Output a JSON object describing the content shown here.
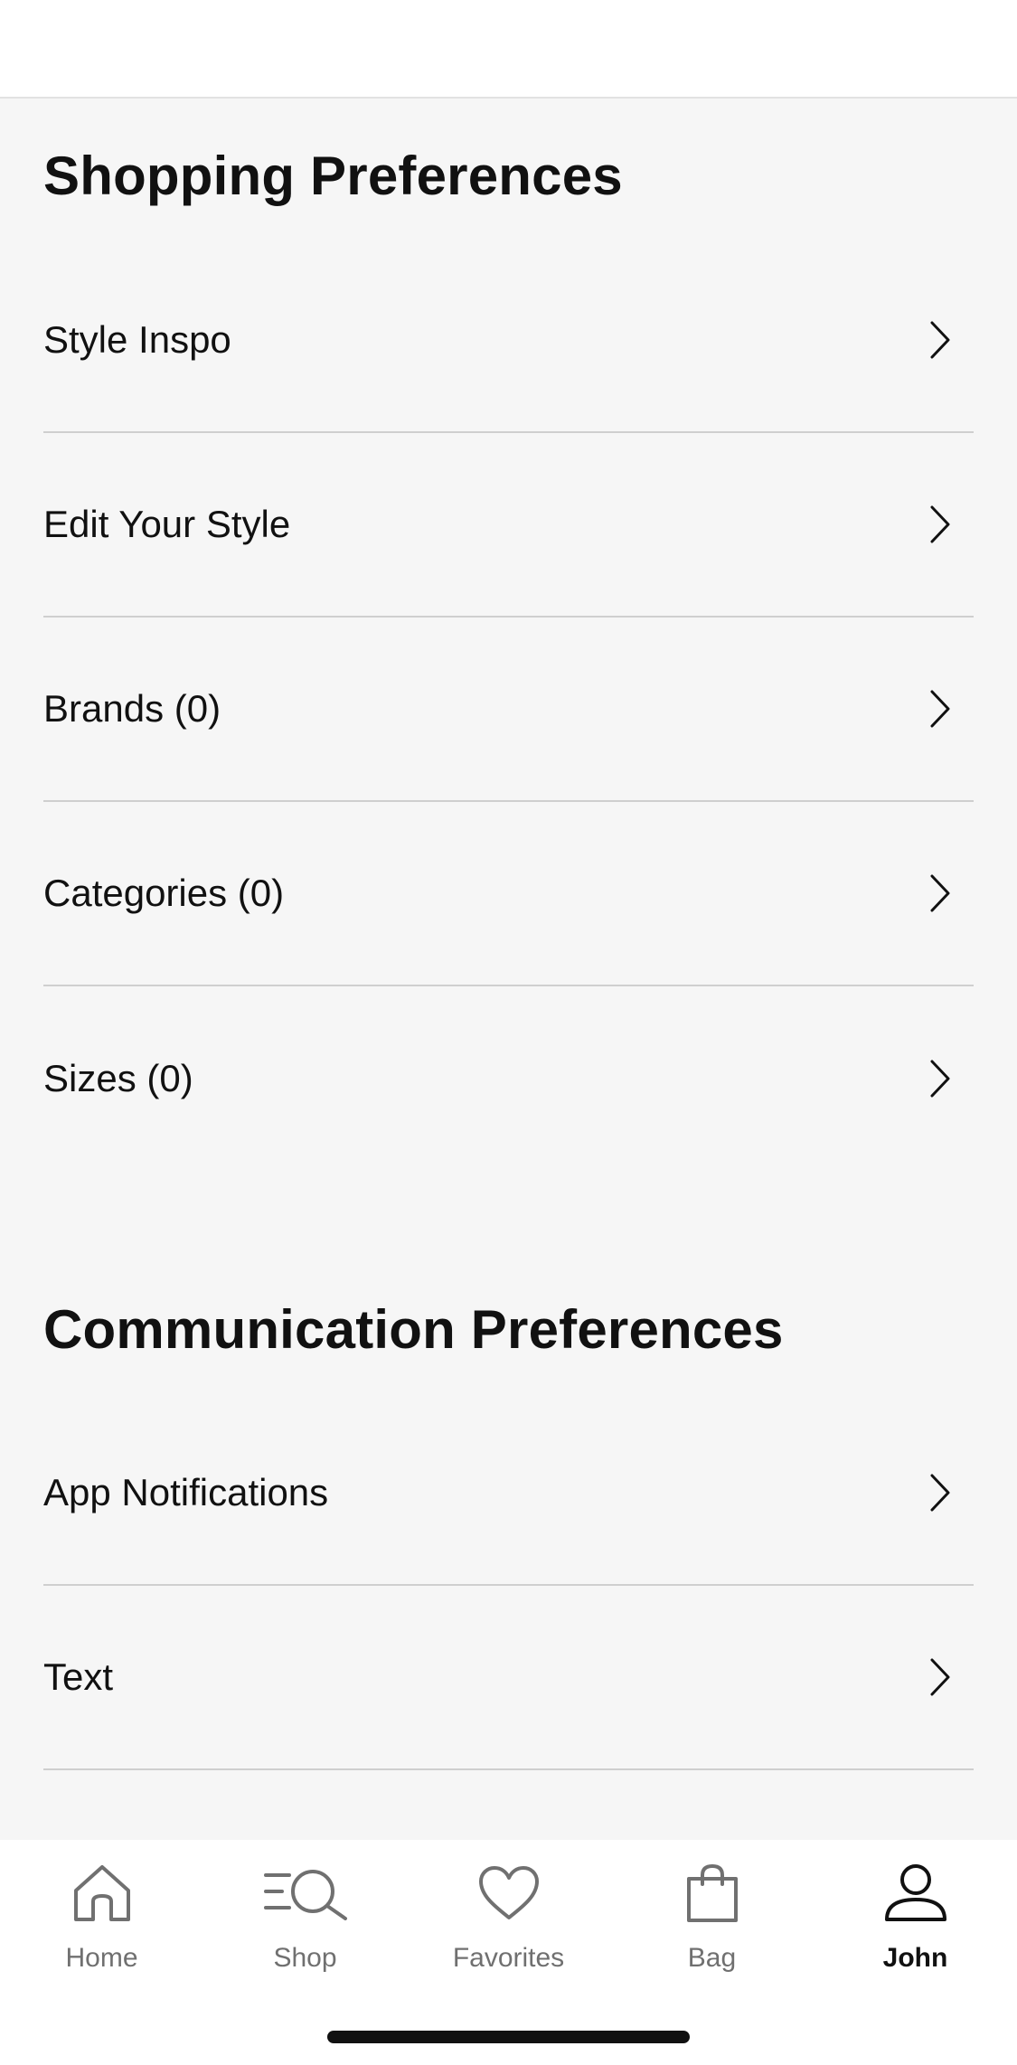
{
  "shopping_preferences": {
    "title": "Shopping Preferences",
    "items": [
      {
        "label": "Style Inspo"
      },
      {
        "label": "Edit Your Style"
      },
      {
        "label": "Brands (0)"
      },
      {
        "label": "Categories (0)"
      },
      {
        "label": "Sizes (0)"
      }
    ]
  },
  "communication_preferences": {
    "title": "Communication Preferences",
    "items": [
      {
        "label": "App Notifications"
      },
      {
        "label": "Text"
      }
    ]
  },
  "tab_bar": {
    "active": "John",
    "tabs": [
      {
        "label": "Home",
        "icon": "home-icon"
      },
      {
        "label": "Shop",
        "icon": "search-icon"
      },
      {
        "label": "Favorites",
        "icon": "heart-icon"
      },
      {
        "label": "Bag",
        "icon": "bag-icon"
      },
      {
        "label": "John",
        "icon": "profile-icon"
      }
    ]
  },
  "colors": {
    "background": "#f6f6f6",
    "text": "#111111",
    "inactive_tab": "#707070",
    "divider": "#cfcfcf"
  }
}
